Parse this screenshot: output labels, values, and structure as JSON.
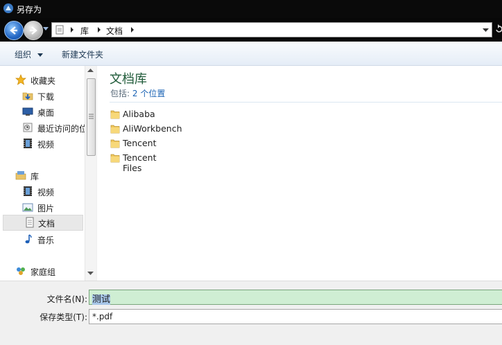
{
  "window": {
    "title": "另存为"
  },
  "address": {
    "crumbs": [
      "库",
      "文档"
    ]
  },
  "toolbar": {
    "organize": "组织",
    "new_folder": "新建文件夹"
  },
  "nav": {
    "favorites": {
      "label": "收藏夹",
      "items": [
        "下载",
        "桌面",
        "最近访问的位",
        "视频"
      ]
    },
    "libraries": {
      "label": "库",
      "items": [
        "视频",
        "图片",
        "文档",
        "音乐"
      ]
    },
    "homegroup": {
      "label": "家庭组"
    }
  },
  "library": {
    "title": "文档库",
    "includes_label": "包括:",
    "includes_link": "2 个位置",
    "folders": [
      "Alibaba",
      "AliWorkbench",
      "Tencent",
      "Tencent Files"
    ]
  },
  "form": {
    "filename_label": "文件名(N):",
    "filename_value": "测试",
    "filetype_label": "保存类型(T):",
    "filetype_value": "*.pdf"
  }
}
